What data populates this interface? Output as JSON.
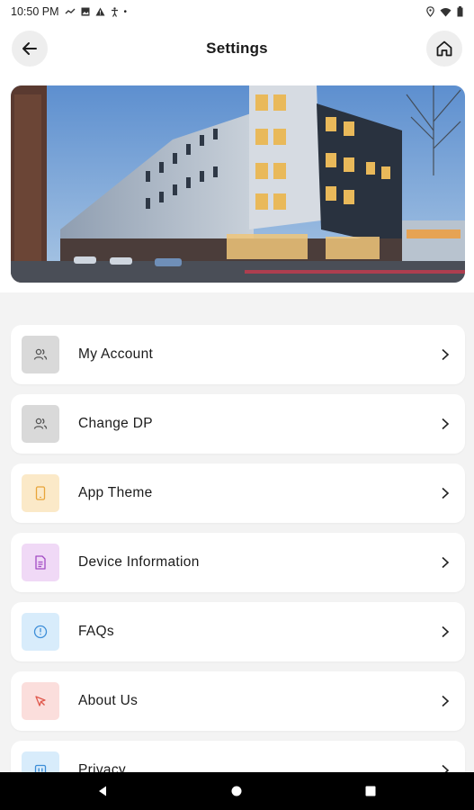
{
  "status_bar": {
    "time": "10:50 PM",
    "dot": "•"
  },
  "header": {
    "title": "Settings",
    "back_icon": "arrow-left-icon",
    "home_icon": "home-icon"
  },
  "hero": {
    "image": "apartment-building-photo"
  },
  "menu": {
    "items": [
      {
        "label": "My Account",
        "icon": "users-icon",
        "tile_color": "#d9d9d9",
        "icon_color": "#555555"
      },
      {
        "label": "Change DP",
        "icon": "users-icon",
        "tile_color": "#d9d9d9",
        "icon_color": "#555555"
      },
      {
        "label": "App Theme",
        "icon": "tablet-icon",
        "tile_color": "#fbe9c8",
        "icon_color": "#e8a53a"
      },
      {
        "label": "Device Information",
        "icon": "document-icon",
        "tile_color": "#f0d9f6",
        "icon_color": "#a24bc4"
      },
      {
        "label": "FAQs",
        "icon": "info-circle-icon",
        "tile_color": "#d8ecfb",
        "icon_color": "#3d8ed8"
      },
      {
        "label": "About Us",
        "icon": "cursor-icon",
        "tile_color": "#fbdedc",
        "icon_color": "#e0584c"
      },
      {
        "label": "Privacy",
        "icon": "privacy-icon",
        "tile_color": "#d8ecfb",
        "icon_color": "#3d8ed8"
      }
    ]
  },
  "nav_bar": {
    "back": "back-triangle-icon",
    "home": "home-circle-icon",
    "recents": "recents-square-icon"
  }
}
